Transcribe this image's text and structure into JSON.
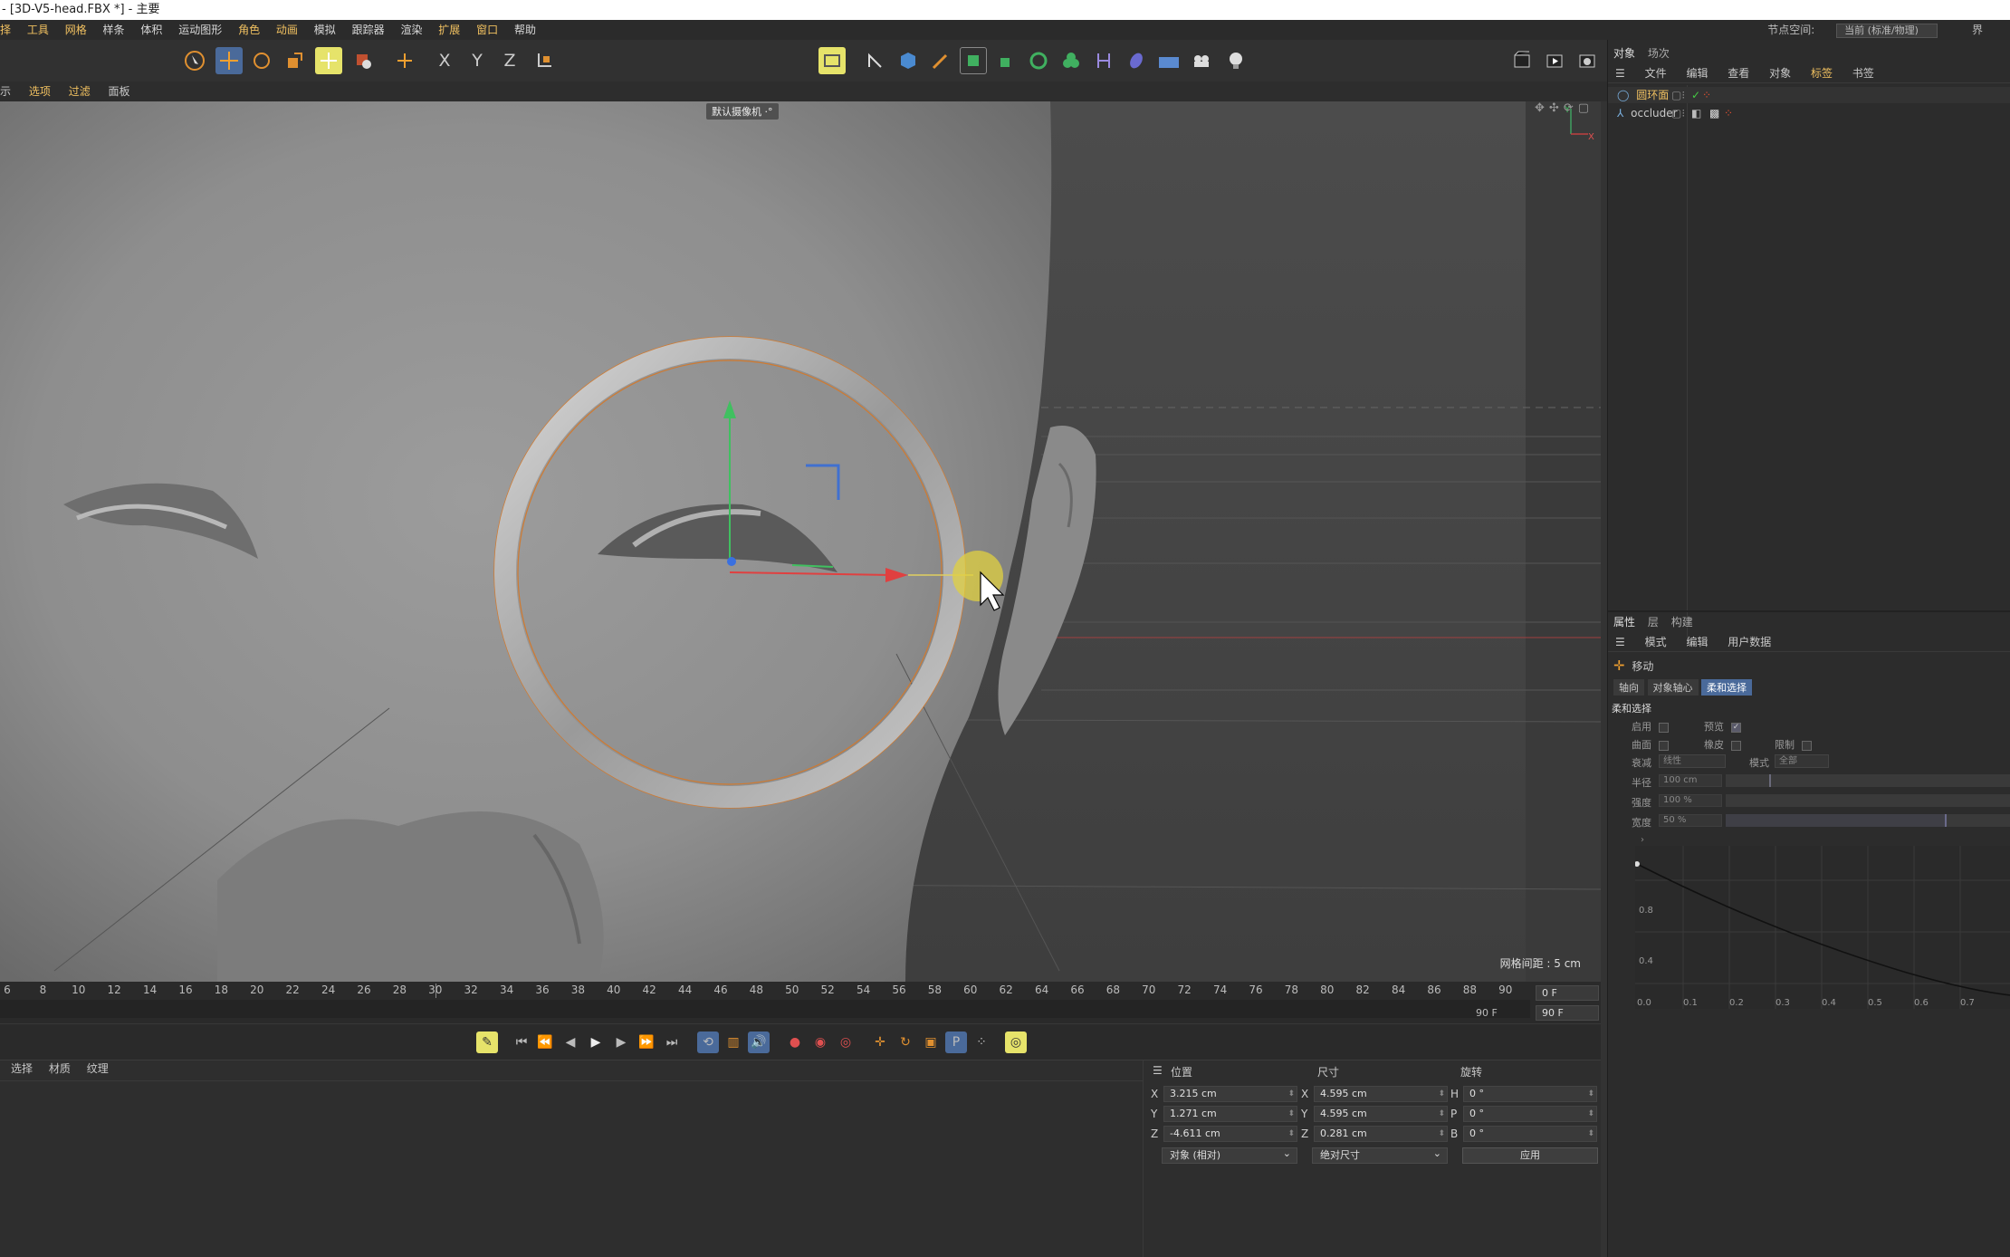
{
  "window": {
    "title": "- [3D-V5-head.FBX *] - 主要"
  },
  "menu": {
    "items": [
      "择",
      "工具",
      "网格",
      "样条",
      "体积",
      "运动图形",
      "角色",
      "动画",
      "模拟",
      "跟踪器",
      "渲染",
      "扩展",
      "窗口",
      "帮助"
    ],
    "node_space_label": "节点空间:",
    "node_space_value": "当前 (标准/物理)",
    "edge_char": "界"
  },
  "view_menu": {
    "items": [
      "示",
      "选项",
      "过滤",
      "面板"
    ]
  },
  "viewport": {
    "camera_label": "默认摄像机 ·°",
    "grid_spacing": "网格间距 : 5 cm",
    "axis_y": "Y",
    "axis_x": "X"
  },
  "timeline": {
    "ticks": [
      "6",
      "8",
      "10",
      "12",
      "14",
      "16",
      "18",
      "20",
      "22",
      "24",
      "26",
      "28",
      "30",
      "32",
      "34",
      "36",
      "38",
      "40",
      "42",
      "44",
      "46",
      "48",
      "50",
      "52",
      "54",
      "56",
      "58",
      "60",
      "62",
      "64",
      "66",
      "68",
      "70",
      "72",
      "74",
      "76",
      "78",
      "80",
      "82",
      "84",
      "86",
      "88",
      "90"
    ],
    "current_frame": "0 F",
    "end_frame": "90 F",
    "end_frame_label": "90 F",
    "playhead_frame": 30
  },
  "material_panel": {
    "tabs": [
      "选择",
      "材质",
      "纹理"
    ]
  },
  "coordinates": {
    "headers": {
      "position": "位置",
      "size": "尺寸",
      "rotation": "旋转"
    },
    "rows": [
      {
        "axis": "X",
        "pos": "3.215 cm",
        "size_axis": "X",
        "size": "4.595 cm",
        "rot_axis": "H",
        "rot": "0 °"
      },
      {
        "axis": "Y",
        "pos": "1.271 cm",
        "size_axis": "Y",
        "size": "4.595 cm",
        "rot_axis": "P",
        "rot": "0 °"
      },
      {
        "axis": "Z",
        "pos": "-4.611 cm",
        "size_axis": "Z",
        "size": "0.281 cm",
        "rot_axis": "B",
        "rot": "0 °"
      }
    ],
    "coord_mode": "对象 (相对)",
    "size_mode": "绝对尺寸",
    "apply": "应用"
  },
  "objects_panel": {
    "tabs": [
      "对象",
      "场次"
    ],
    "menu": [
      "文件",
      "编辑",
      "查看",
      "对象",
      "标签",
      "书签"
    ],
    "items": [
      {
        "name": "圆环面",
        "selected": true
      },
      {
        "name": "occluder",
        "selected": false
      }
    ]
  },
  "attributes_panel": {
    "tabs": [
      "属性",
      "层",
      "构建"
    ],
    "menu": [
      "模式",
      "编辑",
      "用户数据"
    ],
    "tool_name": "移动",
    "subtabs": [
      "轴向",
      "对象轴心",
      "柔和选择"
    ],
    "section": "柔和选择",
    "labels": {
      "enable": "启用",
      "preview": "预览",
      "surface": "曲面",
      "rubber": "橡皮",
      "restrict": "限制",
      "falloff": "衰减",
      "falloff_value": "线性",
      "mode": "模式",
      "mode_value": "全部",
      "radius": "半径",
      "radius_value": "100 cm",
      "strength": "强度",
      "strength_value": "100 %",
      "width": "宽度",
      "width_value": "50 %"
    },
    "graph": {
      "y_ticks": [
        "0.8",
        "0.4"
      ],
      "x_ticks": [
        "0.0",
        "0.1",
        "0.2",
        "0.3",
        "0.4",
        "0.5",
        "0.6",
        "0.7"
      ]
    }
  },
  "colors": {
    "accent": "#f0c060",
    "selection": "#4a6a9a",
    "highlight_button": "#e6e36a"
  }
}
